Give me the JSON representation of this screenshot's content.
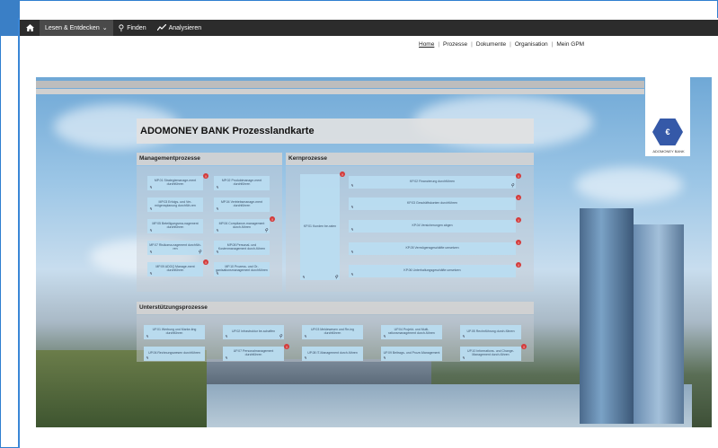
{
  "navbar": {
    "menu_label": "Lesen & Entdecken",
    "find_label": "Finden",
    "analyze_label": "Analysieren"
  },
  "subnav": {
    "links": [
      "Home",
      "Prozesse",
      "Dokumente",
      "Organisation",
      "Mein GPM"
    ]
  },
  "map": {
    "title": "ADOMONEY BANK Prozesslandkarte",
    "logo_text": "ADOMONEY BANK",
    "sections": {
      "management": "Managementprozesse",
      "core": "Kernprozesse",
      "support": "Unterstützungsprozesse"
    },
    "management_items": [
      "MP.01 Strategiemanage-ment durchführen",
      "MP.02 Produktmanage-ment durchführen",
      "MP.03 Erfolgs- und Ver-mögensplanung durchfüh-ren",
      "MP.04 Vertriebsmanage-ment durchführen",
      "MP.05 Beteiligungsma-nagement durchführen",
      "MP.06 Compliance-management durch-führen",
      "MP.07 Risikoma-nagement durchfüh-ren",
      "MP.08 Personal- und Kostenmanagement durch-führen",
      "MP.09 ADOQ Manage-ment durchführen",
      "MP.10 Prozess- und Or-ganisationsmanagement durchführen"
    ],
    "core_side_label": "KP.01 Kunden be-raten",
    "core_items": [
      "KP.02 Finanzierung durchführen",
      "KP.03 Geschäftskonten durchführen",
      "KP.04 Versicherungen abgen",
      "KP.05 Vermögensgeschäfte umsetzen",
      "KP.06 Unterhaltungsgeschäfte umsetzen"
    ],
    "support_items": [
      "UP.01 Werbung und Marke-ting durchführen",
      "UP.02 Infrastruktur be-schaffen",
      "UP.03 Meldewesen und Re-ing durchführen",
      "UP.04 Projekt- und Multi-rationsmanagement durch-führen",
      "UP.05 Rechnführung durch-führen",
      "UP.06 Rechnungswesen durchführen",
      "UP.07 Personalmanagement durchführen",
      "UP.08 IT-Management durch-führen",
      "UP.09 Beitrags- und Proze-Management",
      "UP.10 Informations- und Change-Management durch-führen"
    ],
    "warn_symbol": "!"
  }
}
